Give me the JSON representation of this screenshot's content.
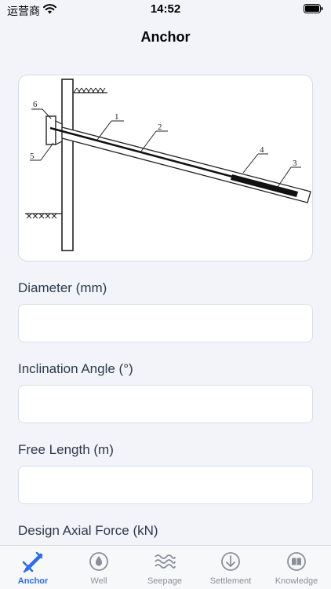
{
  "status_bar": {
    "carrier": "运营商",
    "time": "14:52"
  },
  "nav": {
    "title": "Anchor"
  },
  "figure": {
    "callouts": [
      "1",
      "2",
      "3",
      "4",
      "5",
      "6"
    ]
  },
  "form": {
    "fields": [
      {
        "label": "Diameter (mm)",
        "value": "",
        "placeholder": ""
      },
      {
        "label": "Inclination Angle (°)",
        "value": "",
        "placeholder": ""
      },
      {
        "label": "Free Length (m)",
        "value": "",
        "placeholder": ""
      },
      {
        "label": "Design Axial Force (kN)"
      }
    ]
  },
  "tab_bar": {
    "active_color": "#2a6cf0",
    "inactive_color": "#8a8f99",
    "tabs": [
      {
        "label": "Anchor",
        "icon": "anchor-icon",
        "active": true
      },
      {
        "label": "Well",
        "icon": "water-drop-icon",
        "active": false
      },
      {
        "label": "Seepage",
        "icon": "waves-icon",
        "active": false
      },
      {
        "label": "Settlement",
        "icon": "arrow-down-circle-icon",
        "active": false
      },
      {
        "label": "Knowledge",
        "icon": "book-icon",
        "active": false
      }
    ]
  }
}
